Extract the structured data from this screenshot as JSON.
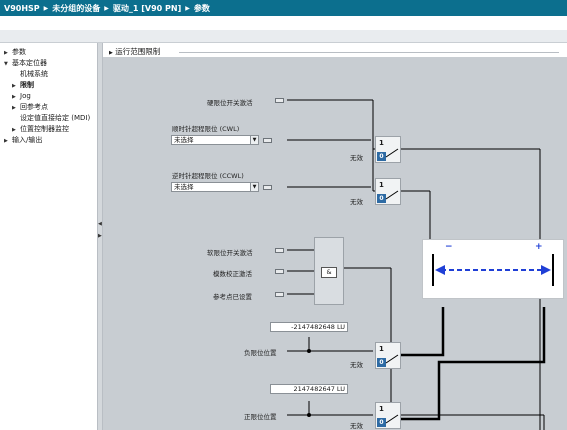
{
  "breadcrumb": [
    "V90HSP",
    "未分组的设备",
    "驱动_1 [V90 PN]",
    "参数"
  ],
  "nav": {
    "items": [
      {
        "label": "参数",
        "arrow": "▶",
        "level": 0
      },
      {
        "label": "基本定位器",
        "arrow": "▼",
        "level": 0
      },
      {
        "label": "机械系统",
        "arrow": "",
        "level": 1
      },
      {
        "label": "限制",
        "arrow": "▶",
        "level": 1,
        "selected": true
      },
      {
        "label": "Jog",
        "arrow": "▶",
        "level": 1
      },
      {
        "label": "回参考点",
        "arrow": "▶",
        "level": 1
      },
      {
        "label": "设定值直接给定 (MDI)",
        "arrow": "",
        "level": 1
      },
      {
        "label": "位置控制器监控",
        "arrow": "▶",
        "level": 1
      },
      {
        "label": "输入/输出",
        "arrow": "▶",
        "level": 0
      }
    ]
  },
  "content": {
    "section_title": "运行范围限制"
  },
  "diagram": {
    "hw_limit_label": "硬限位开关激活",
    "cw_label": "顺时针超程限位 (CWL)",
    "cw_select": "未选择",
    "ccw_label": "逆时针超程限位 (CCWL)",
    "ccw_select": "未选择",
    "sw_limit_label": "软限位开关激活",
    "modulo_label": "模数校正激活",
    "ref_label": "参考点已设置",
    "and_symbol": "&",
    "neg_value": "-2147482648 LU",
    "neg_label": "负限位位置",
    "pos_value": "2147482647 LU",
    "pos_label": "正限位位置",
    "invalid_label": "无效",
    "one": "1",
    "zero": "0",
    "minus_sign": "−",
    "plus_sign": "+"
  },
  "colors": {
    "titlebar": "#0c6f8e",
    "arrow_blue": "#1f3fd6",
    "switch_zero": "#2e6ba4"
  }
}
